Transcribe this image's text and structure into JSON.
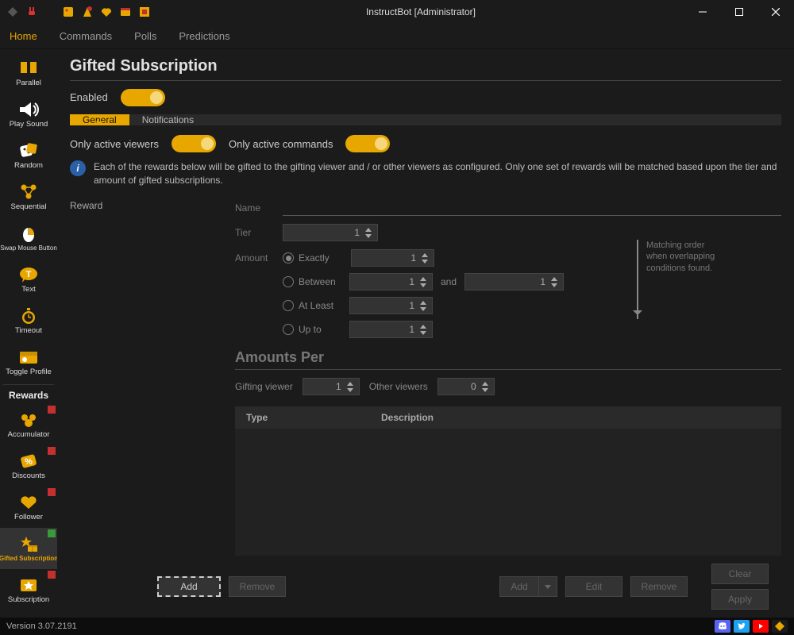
{
  "window": {
    "title": "InstructBot [Administrator]"
  },
  "menubar": {
    "items": [
      "Home",
      "Commands",
      "Polls",
      "Predictions"
    ],
    "active_index": 0
  },
  "sidebar": {
    "items": [
      {
        "label": "Parallel"
      },
      {
        "label": "Play Sound"
      },
      {
        "label": "Random"
      },
      {
        "label": "Sequential"
      },
      {
        "label": "Swap Mouse Button"
      },
      {
        "label": "Text"
      },
      {
        "label": "Timeout"
      },
      {
        "label": "Toggle Profile"
      },
      {
        "label": "Rewards"
      },
      {
        "label": "Accumulator",
        "badge": "#c43030"
      },
      {
        "label": "Discounts",
        "badge": "#c43030"
      },
      {
        "label": "Follower",
        "badge": "#c43030"
      },
      {
        "label": "Gifted Subscription",
        "badge": "#3a9a3a"
      },
      {
        "label": "Subscription",
        "badge": "#c43030"
      }
    ],
    "active_index": 12,
    "separator_after_index": 7
  },
  "page": {
    "title": "Gifted Subscription",
    "enabled_label": "Enabled",
    "tabs": [
      "General",
      "Notifications"
    ],
    "active_tab": 0,
    "active_viewers_label": "Only active viewers",
    "active_commands_label": "Only active commands",
    "info_text": "Each of the rewards below will be gifted to the gifting viewer and / or other viewers as configured. Only one set of rewards will be matched based upon the tier and amount of gifted subscriptions.",
    "reward_heading": "Reward",
    "name_label": "Name",
    "tier_label": "Tier",
    "tier_value": "1",
    "amount_label": "Amount",
    "amount_options": {
      "exactly": {
        "label": "Exactly",
        "value": "1"
      },
      "between": {
        "label": "Between",
        "from": "1",
        "to": "1",
        "and": "and"
      },
      "at_least": {
        "label": "At Least",
        "value": "1"
      },
      "up_to": {
        "label": "Up to",
        "value": "1"
      }
    },
    "selected_amount": "exactly",
    "arrow_note": "Matching order when overlapping conditions found.",
    "amounts_per_heading": "Amounts Per",
    "gifting_viewer_label": "Gifting viewer",
    "gifting_viewer_value": "1",
    "other_viewers_label": "Other viewers",
    "other_viewers_value": "0",
    "table": {
      "col_type": "Type",
      "col_desc": "Description"
    }
  },
  "footer": {
    "left_add": "Add",
    "left_remove": "Remove",
    "right_add": "Add",
    "right_edit": "Edit",
    "right_remove": "Remove",
    "clear": "Clear",
    "apply": "Apply"
  },
  "statusbar": {
    "version": "Version 3.07.2191"
  }
}
